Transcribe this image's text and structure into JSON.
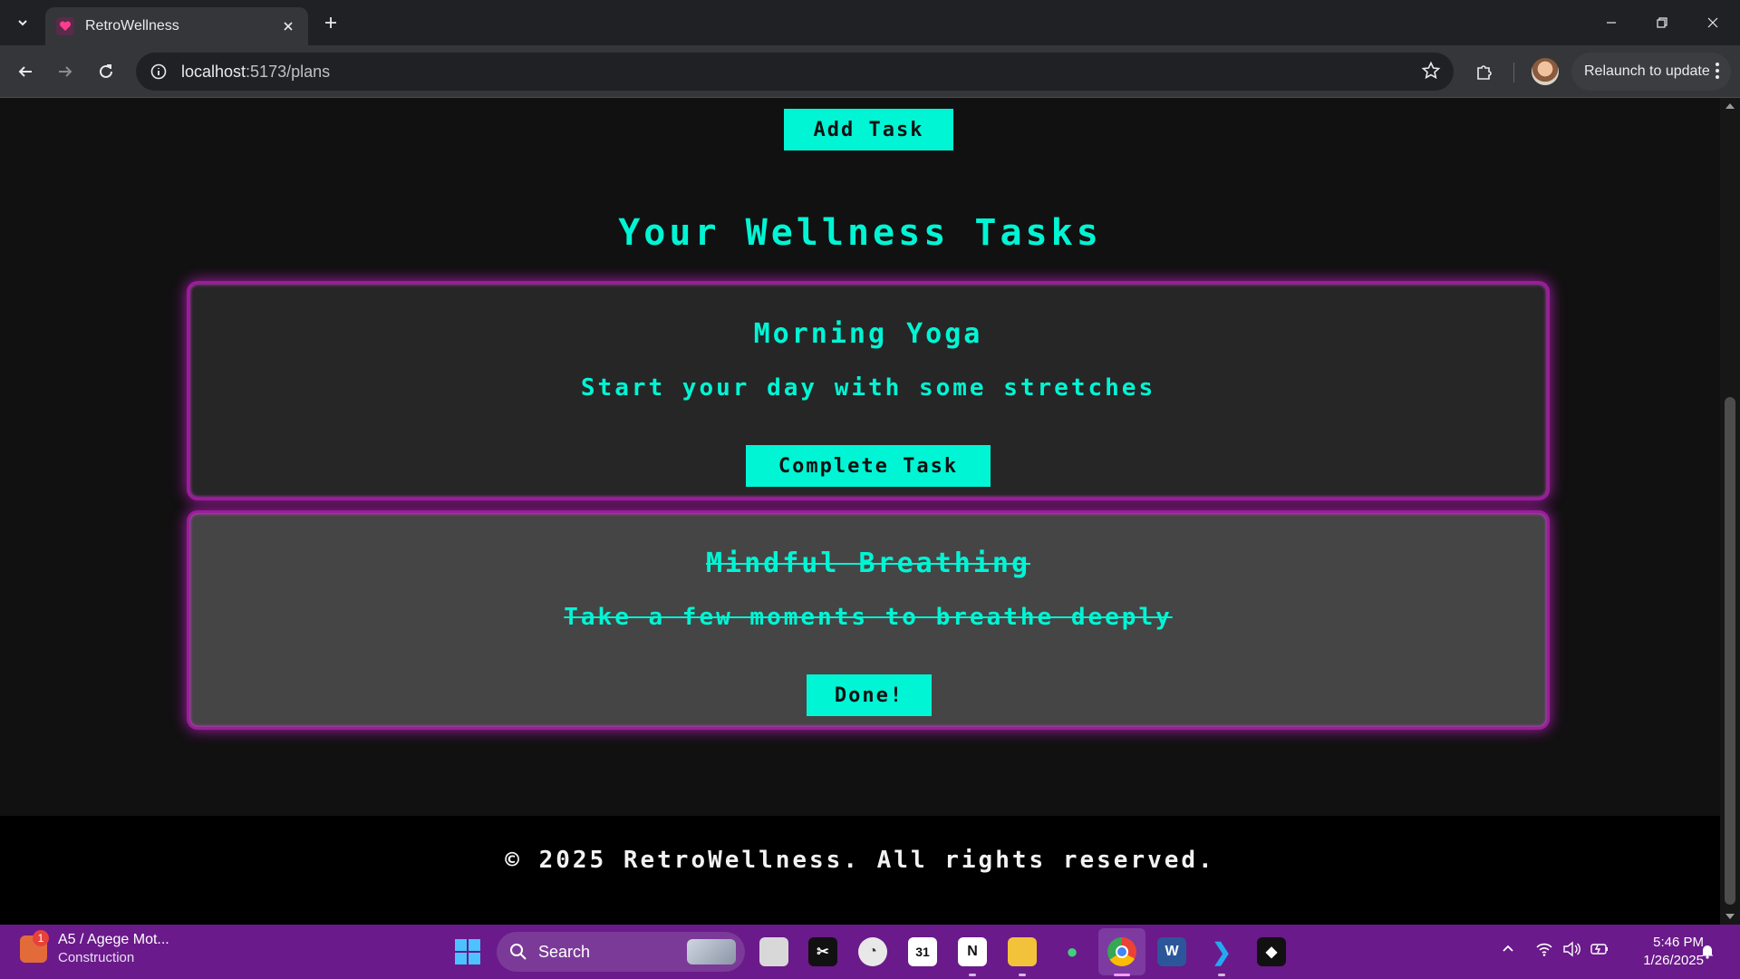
{
  "browser": {
    "tab_title": "RetroWellness",
    "url_host": "localhost",
    "url_path": ":5173/plans",
    "relaunch_label": "Relaunch to update"
  },
  "page": {
    "add_task_label": "Add Task",
    "section_title": "Your Wellness Tasks",
    "tasks": [
      {
        "title": "Morning Yoga",
        "description": "Start your day with some stretches",
        "button_label": "Complete Task",
        "completed": false
      },
      {
        "title": "Mindful Breathing",
        "description": "Take a few moments to breathe deeply",
        "button_label": "Done!",
        "completed": true
      }
    ],
    "footer_text": "© 2025 RetroWellness. All rights reserved."
  },
  "taskbar": {
    "weather_badge": "1",
    "weather_title": "A5 / Agege Mot...",
    "weather_subtitle": "Construction",
    "search_label": "Search",
    "calendar_day": "31",
    "time": "5:46 PM",
    "date": "1/26/2025"
  },
  "colors": {
    "accent": "#00f5d4",
    "card_glow": "#b11cb1",
    "taskbar": "#6a1a8a"
  }
}
